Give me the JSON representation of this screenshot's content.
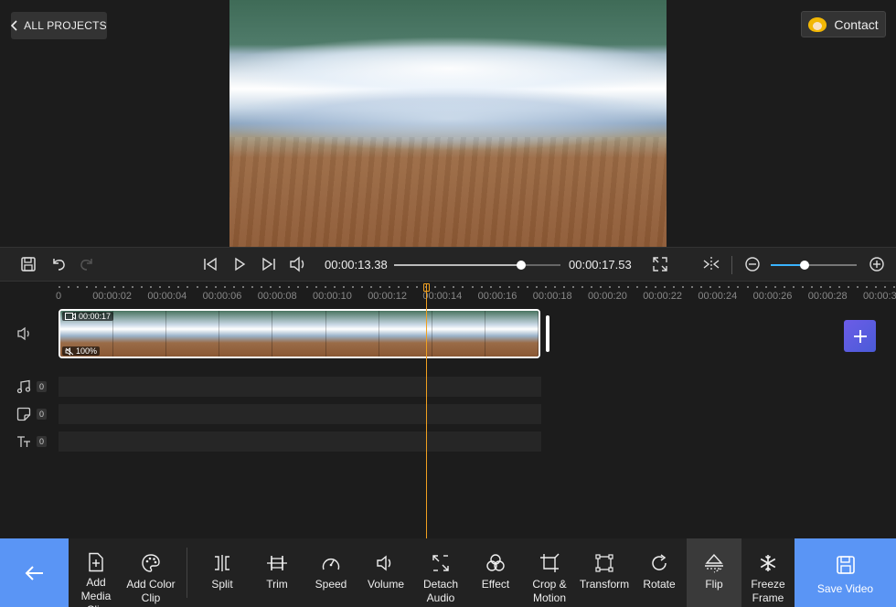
{
  "header": {
    "all_projects_label": "ALL PROJECTS",
    "contact_label": "Contact"
  },
  "player": {
    "current_time": "00:00:13.38",
    "total_time": "00:00:17.53",
    "progress_fraction": 0.763,
    "zoom_fraction": 0.39
  },
  "ruler": {
    "labels": [
      "0",
      "00:00:02",
      "00:00:04",
      "00:00:06",
      "00:00:08",
      "00:00:10",
      "00:00:12",
      "00:00:14",
      "00:00:16",
      "00:00:18",
      "00:00:20",
      "00:00:22",
      "00:00:24",
      "00:00:26",
      "00:00:28",
      "00:00:3"
    ]
  },
  "clip": {
    "duration": "00:00:17",
    "volume": "100%"
  },
  "tracks": {
    "music_count": "0",
    "sticker_count": "0",
    "text_count": "0"
  },
  "toolbar": {
    "add_media_clip": "Add Media Clip",
    "add_color_clip": "Add Color Clip",
    "split": "Split",
    "trim": "Trim",
    "speed": "Speed",
    "volume": "Volume",
    "detach_audio": "Detach Audio",
    "effect": "Effect",
    "crop_motion": "Crop & Motion",
    "transform": "Transform",
    "rotate": "Rotate",
    "flip": "Flip",
    "freeze_frame": "Freeze Frame",
    "save_video": "Save Video"
  },
  "colors": {
    "accent": "#5a95f5",
    "playhead": "#f0a020",
    "zoom": "#3ab3ff"
  }
}
